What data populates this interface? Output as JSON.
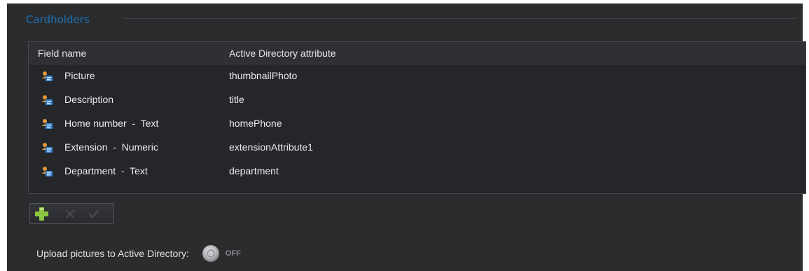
{
  "section": {
    "title": "Cardholders"
  },
  "grid": {
    "columns": [
      "Field name",
      "Active Directory attribute"
    ],
    "rows": [
      {
        "field": "Picture",
        "attribute": "thumbnailPhoto",
        "icon": "cardholder-icon"
      },
      {
        "field": "Description",
        "attribute": "title",
        "icon": "cardholder-icon"
      },
      {
        "field": "Home number  -  Text",
        "attribute": "homePhone",
        "icon": "cardholder-icon"
      },
      {
        "field": "Extension  -  Numeric",
        "attribute": "extensionAttribute1",
        "icon": "cardholder-icon"
      },
      {
        "field": "Department  -  Text",
        "attribute": "department",
        "icon": "cardholder-icon"
      }
    ]
  },
  "toolbar": {
    "add_icon": "plus-icon",
    "delete_icon": "x-icon",
    "confirm_icon": "checkmark-icon",
    "add_color": "#8cc63f"
  },
  "upload": {
    "label": "Upload pictures to Active Directory:",
    "state": "OFF",
    "enabled": false
  },
  "colors": {
    "background": "#2b2c2e",
    "accent": "#1b6fb5",
    "text": "#ececec"
  }
}
